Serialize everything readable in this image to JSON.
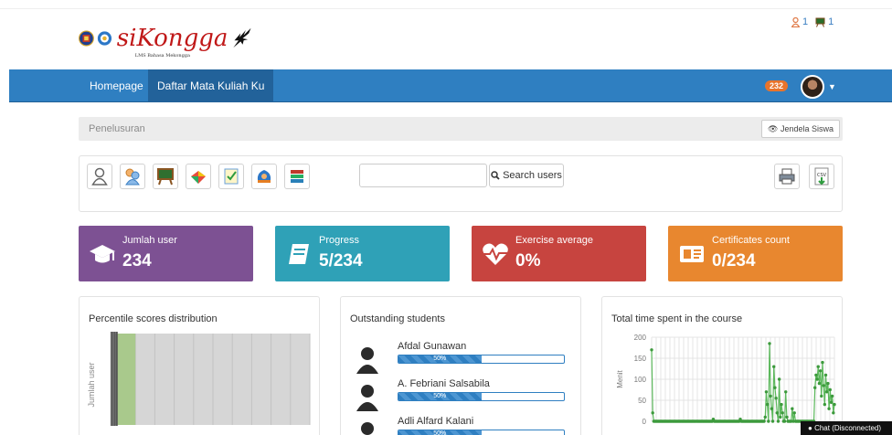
{
  "header": {
    "logo_text": "siKongga",
    "logo_sub": "LMS Bahasa Mekongga",
    "user_count": "1",
    "course_count": "1"
  },
  "navbar": {
    "home": "Homepage",
    "courses": "Daftar Mata Kuliah Ku",
    "badge": "232"
  },
  "breadcrumb": {
    "text": "Penelusuran",
    "student_view": "Jendela Siswa"
  },
  "toolbar": {
    "tools": [
      "user-icon",
      "group-icon",
      "teacher-icon",
      "skills-icon",
      "exercise-icon",
      "course-icon",
      "books-icon"
    ],
    "search_placeholder": "",
    "search_button": "Search users",
    "print": "print-icon",
    "export": "csv-icon"
  },
  "cards": [
    {
      "label": "Jumlah user",
      "value": "234",
      "color": "#7d5193",
      "icon": "graduation-cap-icon"
    },
    {
      "label": "Progress",
      "value": "5/234",
      "color": "#2fa1b7",
      "icon": "book-icon"
    },
    {
      "label": "Exercise average",
      "value": "0%",
      "color": "#d84c46",
      "icon": "heartbeat-icon"
    },
    {
      "label": "Certificates count",
      "value": "0/234",
      "color": "#f09a36",
      "icon": "certificate-icon"
    }
  ],
  "panels": {
    "percentile_title": "Percentile scores distribution",
    "percentile_ylabel": "Jumlah user",
    "outstanding_title": "Outstanding students",
    "students": [
      {
        "name": "Afdal Gunawan",
        "progress": 50
      },
      {
        "name": "A. Febriani Salsabila",
        "progress": 50
      },
      {
        "name": "Adli Alfard Kalani",
        "progress": 50
      }
    ],
    "time_title": "Total time spent in the course",
    "time_ylabel": "Menit"
  },
  "chart_data": [
    {
      "type": "bar",
      "title": "Percentile scores distribution",
      "ylabel": "Jumlah user",
      "xlabel": "",
      "values": [
        234,
        0,
        0,
        0,
        0,
        0,
        0,
        0,
        0,
        0
      ]
    },
    {
      "type": "line",
      "title": "Total time spent in the course",
      "ylabel": "Menit",
      "xlabel": "",
      "ylim": [
        0,
        200
      ],
      "yticks": [
        200,
        150,
        100,
        50,
        0
      ],
      "values": [
        170,
        20,
        0,
        0,
        0,
        0,
        0,
        0,
        0,
        0,
        0,
        0,
        0,
        0,
        0,
        0,
        0,
        0,
        0,
        0,
        0,
        0,
        0,
        0,
        0,
        0,
        0,
        0,
        0,
        0,
        0,
        0,
        0,
        0,
        0,
        0,
        0,
        0,
        0,
        0,
        0,
        0,
        0,
        0,
        0,
        0,
        0,
        0,
        0,
        0,
        0,
        0,
        0,
        0,
        0,
        0,
        0,
        5,
        0,
        0,
        0,
        0,
        0,
        0,
        0,
        0,
        0,
        0,
        0,
        0,
        0,
        0,
        0,
        0,
        0,
        0,
        0,
        0,
        0,
        0,
        0,
        0,
        5,
        0,
        0,
        0,
        0,
        0,
        0,
        0,
        0,
        0,
        0,
        0,
        0,
        0,
        0,
        0,
        0,
        0,
        0,
        0,
        0,
        0,
        0,
        10,
        70,
        40,
        0,
        185,
        60,
        30,
        0,
        130,
        80,
        55,
        20,
        0,
        100,
        10,
        40,
        20,
        0,
        0,
        70,
        10,
        0,
        0,
        0,
        0,
        30,
        0,
        20,
        0,
        0,
        0,
        0,
        0,
        0,
        0,
        0,
        0,
        0,
        0,
        0,
        0,
        0,
        0,
        0,
        0,
        0,
        80,
        110,
        100,
        130,
        90,
        120,
        60,
        140,
        85,
        40,
        110,
        70,
        90,
        30,
        75,
        45,
        60,
        20,
        40
      ]
    }
  ],
  "chat": "Chat (Disconnected)"
}
